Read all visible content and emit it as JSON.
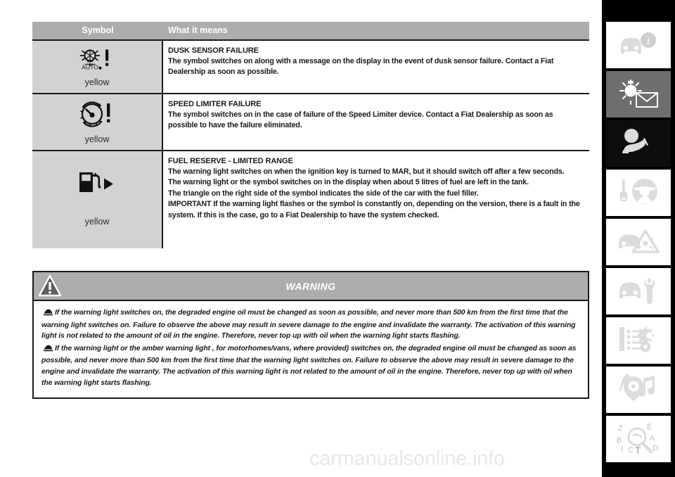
{
  "table": {
    "headers": {
      "symbol": "Symbol",
      "meaning": "What it means"
    },
    "rows": [
      {
        "icon": "dusk-sensor-failure-icon",
        "color_label": "yellow",
        "title": "DUSK SENSOR FAILURE",
        "body": "The symbol switches on along with a message on the display in the event of dusk sensor failure. Contact a Fiat Dealership as soon as possible."
      },
      {
        "icon": "speed-limiter-failure-icon",
        "color_label": "yellow",
        "title": "SPEED LIMITER FAILURE",
        "body": "The symbol switches on in the case of failure of the Speed Limiter device. Contact a Fiat Dealership as soon as possible to have the failure eliminated."
      },
      {
        "icon": "fuel-reserve-icon",
        "color_label": "yellow",
        "title": "FUEL RESERVE - LIMITED RANGE",
        "body_lines": [
          "The warning light switches on when the ignition key is turned to MAR, but it should switch off after a few seconds.",
          "The warning light or the symbol switches on in the display when about 5 litres of fuel are left in the tank.",
          "The triangle on the right side of the symbol indicates the side of the car with the fuel filler.",
          "IMPORTANT If the warning light flashes or the symbol is constantly on, depending on the version, there is a fault in the system. If this is the case, go to a Fiat Dealership to have the system checked."
        ]
      }
    ]
  },
  "warning": {
    "title": "WARNING",
    "icon": "warning-triangle-icon",
    "paragraphs": [
      "If the warning light switches on, the degraded engine oil must be changed as soon as possible, and never more than 500 km from the first time that the warning light switches on. Failure to observe the above may result in severe damage to the engine and invalidate the warranty. The activation of this warning light is not related to the amount of oil in the engine. Therefore, never top up with oil when the warning light starts flashing.",
      "If the warning light  or the amber warning light , for motorhomes/vans, where provided) switches on, the degraded engine oil must be changed as soon as possible, and never more than 500 km from the first time that the warning light switches on. Failure to observe the above may result in severe damage to the engine and invalidate the warranty. The activation of this warning light is not related to the amount of oil in the engine. Therefore, never top up with oil when the warning light starts flashing."
    ]
  },
  "sidebar": {
    "items": [
      {
        "name": "dashboard-and-controls",
        "icon": "car-info-icon",
        "state": "inactive"
      },
      {
        "name": "warning-lights-and-messages",
        "icon": "warning-light-message-icon",
        "state": "active"
      },
      {
        "name": "safety",
        "icon": "child-safety-icon",
        "state": "dark"
      },
      {
        "name": "starting-and-driving",
        "icon": "key-steering-wheel-icon",
        "state": "inactive"
      },
      {
        "name": "in-an-emergency",
        "icon": "car-hazard-triangle-icon",
        "state": "inactive"
      },
      {
        "name": "maintenance-and-care",
        "icon": "car-wrench-icon",
        "state": "inactive"
      },
      {
        "name": "technical-specifications",
        "icon": "list-gear-icon",
        "state": "inactive"
      },
      {
        "name": "multimedia",
        "icon": "media-audio-icon",
        "state": "inactive"
      },
      {
        "name": "alphabetical-index",
        "icon": "index-magnifier-icon",
        "state": "inactive"
      }
    ]
  },
  "watermark": {
    "text": "carmanualsonline.info"
  },
  "colors": {
    "header_gray": "#adadad",
    "cell_gray": "#d2d2d2",
    "ink": "#1a1a1a",
    "active_gray": "#6e6e6e"
  }
}
